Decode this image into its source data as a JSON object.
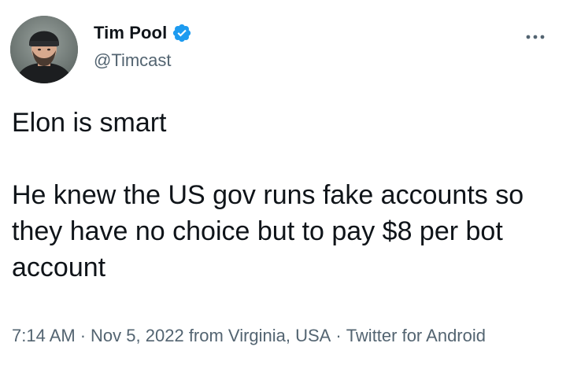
{
  "author": {
    "display_name": "Tim Pool",
    "handle": "@Timcast",
    "verified": true,
    "verified_color": "#1d9bf0"
  },
  "tweet": {
    "text": "Elon is smart\n\nHe knew the US gov runs fake accounts so they have no choice but to pay $8 per bot account"
  },
  "meta": {
    "time": "7:14 AM",
    "separator": "·",
    "date": "Nov 5, 2022",
    "location": "from Virginia, USA",
    "client": "Twitter for Android"
  },
  "icons": {
    "more": "more-icon",
    "verified": "verified-badge-icon"
  }
}
